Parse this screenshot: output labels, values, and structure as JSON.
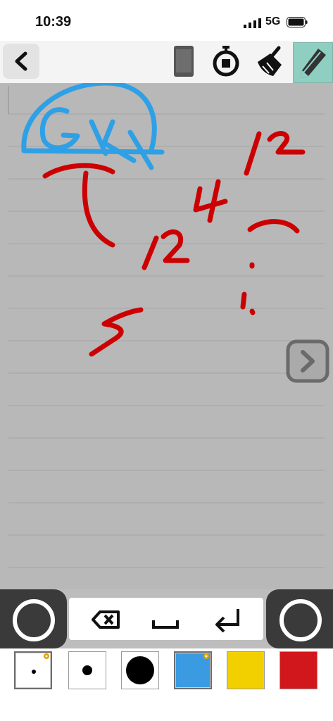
{
  "status_bar": {
    "time": "10:39",
    "network": "5G"
  },
  "toolbar": {
    "icons": [
      "chevron-left-icon",
      "phone-icon",
      "stopwatch-icon",
      "broom-icon",
      "pencil-icon"
    ],
    "active_tool": "pencil"
  },
  "canvas": {
    "paper": "lined",
    "background": "#b8b8b8",
    "ink_colors": {
      "red": "#cc0000",
      "blue": "#2ea0e6"
    }
  },
  "keypad": {
    "keys": [
      "backspace-icon",
      "space-icon",
      "return-icon"
    ]
  },
  "swatches": [
    {
      "name": "small-pen",
      "color": "#ffffff",
      "selected": true
    },
    {
      "name": "medium-pen",
      "color": "#ffffff",
      "selected": false
    },
    {
      "name": "large-pen",
      "color": "#ffffff",
      "selected": false
    },
    {
      "name": "blue",
      "color": "#3a9be2",
      "selected": true
    },
    {
      "name": "yellow",
      "color": "#f2d000",
      "selected": false
    },
    {
      "name": "red",
      "color": "#d1171b",
      "selected": false
    }
  ]
}
